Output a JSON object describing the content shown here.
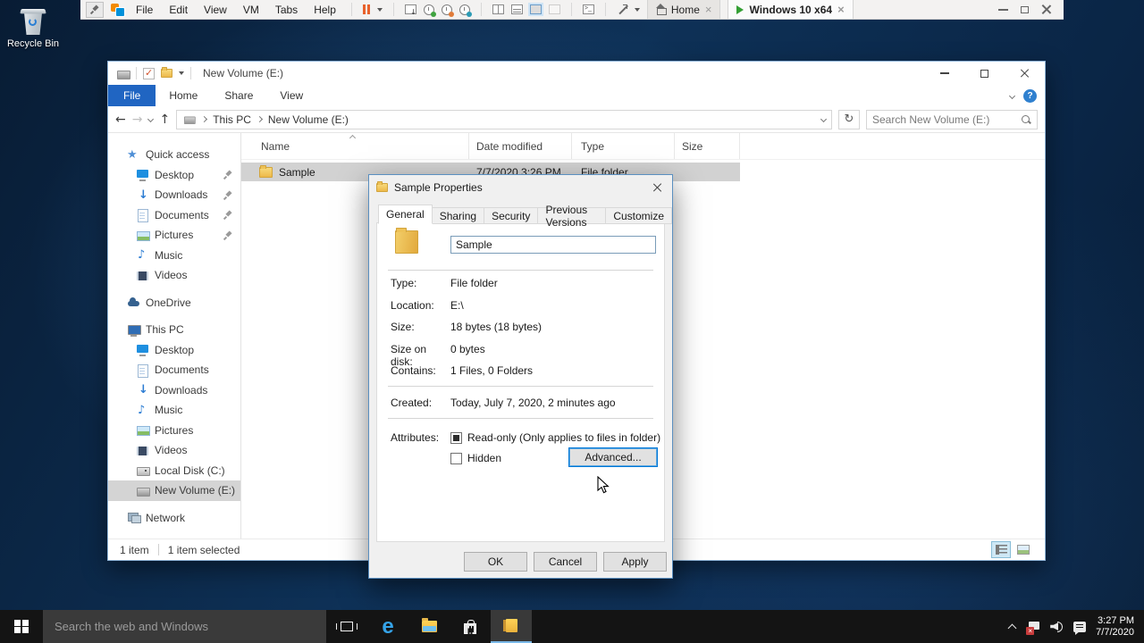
{
  "vm_toolbar": {
    "menus": [
      "File",
      "Edit",
      "View",
      "VM",
      "Tabs",
      "Help"
    ],
    "tabs": [
      {
        "label": "Home"
      },
      {
        "label": "Windows 10 x64"
      }
    ]
  },
  "desktop": {
    "recycle_bin_label": "Recycle Bin"
  },
  "explorer": {
    "title": "New Volume (E:)",
    "ribbon_tabs": [
      "File",
      "Home",
      "Share",
      "View"
    ],
    "breadcrumb": [
      "This PC",
      "New Volume (E:)"
    ],
    "search_placeholder": "Search New Volume (E:)",
    "columns": [
      "Name",
      "Date modified",
      "Type",
      "Size"
    ],
    "files": [
      {
        "name": "Sample",
        "date_modified": "7/7/2020 3:26 PM",
        "type": "File folder",
        "size": ""
      }
    ],
    "sidebar": {
      "items": [
        {
          "label": "Quick access"
        },
        {
          "label": "Desktop"
        },
        {
          "label": "Downloads"
        },
        {
          "label": "Documents"
        },
        {
          "label": "Pictures"
        },
        {
          "label": "Music"
        },
        {
          "label": "Videos"
        },
        {
          "label": "OneDrive"
        },
        {
          "label": "This PC"
        },
        {
          "label": "Desktop"
        },
        {
          "label": "Documents"
        },
        {
          "label": "Downloads"
        },
        {
          "label": "Music"
        },
        {
          "label": "Pictures"
        },
        {
          "label": "Videos"
        },
        {
          "label": "Local Disk (C:)"
        },
        {
          "label": "New Volume (E:)"
        },
        {
          "label": "Network"
        }
      ]
    },
    "status_bar": {
      "item_count": "1 item",
      "selection": "1 item selected"
    }
  },
  "dialog": {
    "title": "Sample Properties",
    "tabs": [
      {
        "label": "General"
      },
      {
        "label": "Sharing"
      },
      {
        "label": "Security"
      },
      {
        "label": "Previous Versions"
      },
      {
        "label": "Customize"
      }
    ],
    "name_field_value": "Sample",
    "properties": [
      {
        "label": "Type:",
        "value": "File folder"
      },
      {
        "label": "Location:",
        "value": "E:\\"
      },
      {
        "label": "Size:",
        "value": "18 bytes (18 bytes)"
      },
      {
        "label": "Size on disk:",
        "value": "0 bytes"
      },
      {
        "label": "Contains:",
        "value": "1 Files, 0 Folders"
      }
    ],
    "created": {
      "label": "Created:",
      "value": "Today, July 7, 2020, 2 minutes ago"
    },
    "attributes": {
      "label": "Attributes:",
      "readonly_label": "Read-only (Only applies to files in folder)",
      "hidden_label": "Hidden",
      "advanced_button": "Advanced..."
    },
    "footer_buttons": [
      {
        "label": "OK"
      },
      {
        "label": "Cancel"
      },
      {
        "label": "Apply"
      }
    ]
  },
  "taskbar": {
    "search_placeholder": "Search the web and Windows",
    "clock_time": "3:27 PM",
    "clock_date": "7/7/2020"
  },
  "colors": {
    "file_tab_blue": "#2065c2",
    "selection_gray": "#d2d2d2",
    "folder_yellow": "#f0c04e",
    "vmware_orange": "#f38b00",
    "vmware_blue": "#0091da",
    "taskbar_bg": "#141414",
    "desktop_blue": "#0d2c50",
    "focus_blue": "#0078d7"
  }
}
